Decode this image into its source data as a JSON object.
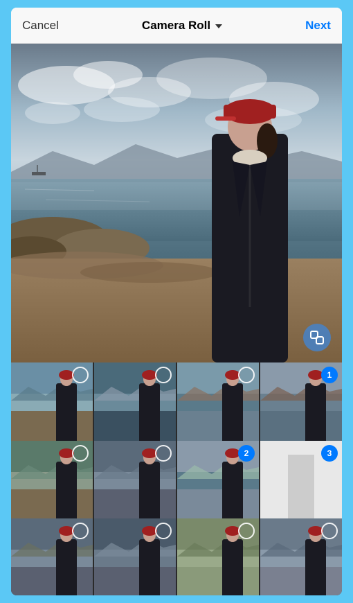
{
  "header": {
    "cancel_label": "Cancel",
    "title_label": "Camera Roll",
    "next_label": "Next",
    "accent_color": "#007aff"
  },
  "thumbnails": [
    {
      "id": 1,
      "selected": false,
      "badge": null,
      "bg": "thumb-bg-1",
      "has_person": true,
      "row": 1
    },
    {
      "id": 2,
      "selected": false,
      "badge": null,
      "bg": "thumb-bg-2",
      "has_person": true,
      "row": 1
    },
    {
      "id": 3,
      "selected": false,
      "badge": null,
      "bg": "thumb-bg-3",
      "has_person": true,
      "row": 1
    },
    {
      "id": 4,
      "selected": true,
      "badge": "1",
      "bg": "thumb-bg-4",
      "has_person": true,
      "row": 1
    },
    {
      "id": 5,
      "selected": false,
      "badge": null,
      "bg": "thumb-bg-5",
      "has_person": true,
      "row": 2
    },
    {
      "id": 6,
      "selected": false,
      "badge": null,
      "bg": "thumb-bg-6",
      "has_person": true,
      "row": 2
    },
    {
      "id": 7,
      "selected": true,
      "badge": "2",
      "bg": "thumb-bg-7",
      "has_person": true,
      "row": 2
    },
    {
      "id": 8,
      "selected": true,
      "badge": "3",
      "bg": "thumb-bg-8",
      "has_person": false,
      "row": 2
    },
    {
      "id": 9,
      "selected": false,
      "badge": null,
      "bg": "thumb-bg-9",
      "has_person": true,
      "row": 3
    },
    {
      "id": 10,
      "selected": false,
      "badge": null,
      "bg": "thumb-bg-10",
      "has_person": true,
      "row": 3
    },
    {
      "id": 11,
      "selected": false,
      "badge": null,
      "bg": "thumb-bg-11",
      "has_person": true,
      "row": 3
    },
    {
      "id": 12,
      "selected": false,
      "badge": null,
      "bg": "thumb-bg-12",
      "has_person": true,
      "row": 3
    }
  ],
  "expand_icon_label": "expand"
}
